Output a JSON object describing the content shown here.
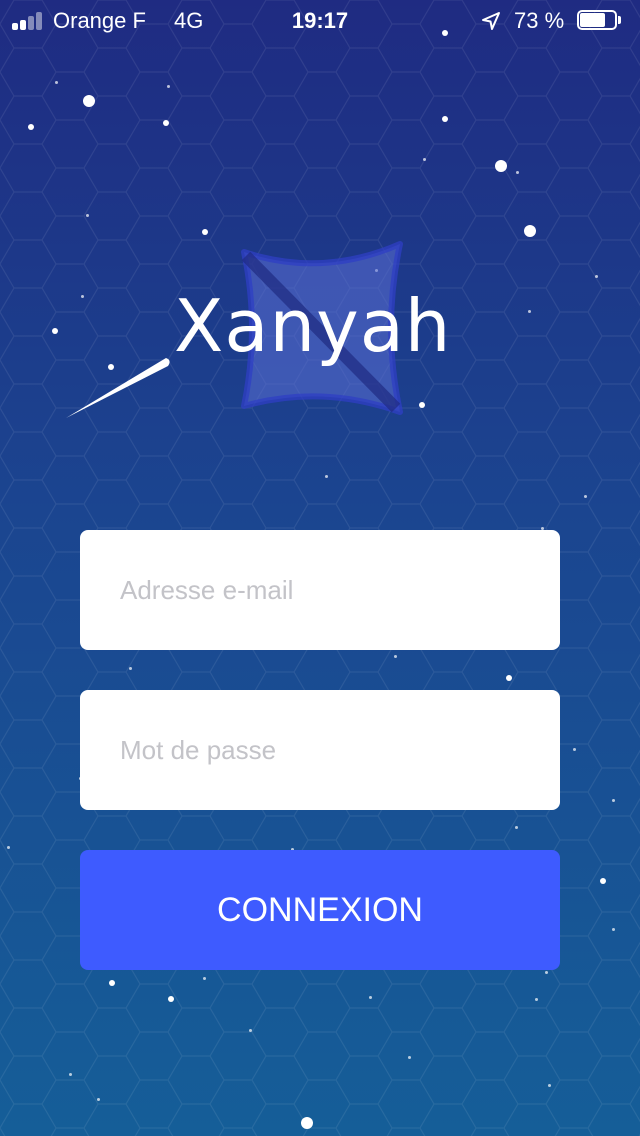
{
  "status_bar": {
    "carrier": "Orange F",
    "network": "4G",
    "time": "19:17",
    "battery_percent": "73 %",
    "battery_level": 0.73,
    "signal_bars_filled": 2,
    "signal_bars_total": 4,
    "icons": [
      "signal-icon",
      "location-arrow-icon",
      "battery-icon"
    ]
  },
  "logo": {
    "wordmark": "Xanyah",
    "icons": [
      "comet-icon",
      "bowtie-emblem-icon"
    ]
  },
  "login_form": {
    "email_placeholder": "Adresse e-mail",
    "email_value": "",
    "password_placeholder": "Mot de passe",
    "password_value": "",
    "submit_label": "CONNEXION"
  },
  "colors": {
    "background_top": "#1f2b82",
    "background_bottom": "#155e98",
    "button": "#3e5bff",
    "field": "#ffffff",
    "placeholder": "#c3c3c8",
    "text_light": "#ffffff"
  }
}
